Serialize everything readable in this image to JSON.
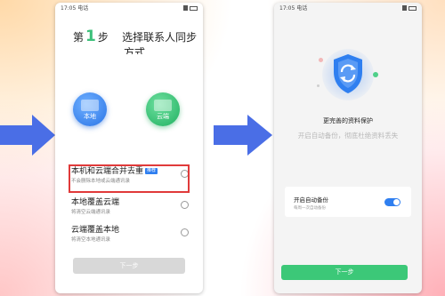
{
  "colors": {
    "accent_green": "#3cc07a",
    "accent_blue": "#2f7ff0",
    "highlight_red": "#e03a3a",
    "arrow_blue": "#4a6ee6"
  },
  "left_screen": {
    "status_time": "17:05",
    "status_text": "电话",
    "step_prefix": "第",
    "step_number": "1",
    "step_suffix": "步",
    "title_line1": "选择联系人同步",
    "title_line2": "方式",
    "option_local_label": "本地",
    "option_cloud_label": "云端",
    "options": [
      {
        "main": "本机和云端合并去重",
        "badge": "推荐",
        "sub": "不会删除本地或云端通讯录"
      },
      {
        "main": "本地覆盖云端",
        "sub": "将清空云端通讯录"
      },
      {
        "main": "云端覆盖本地",
        "sub": "将清空本地通讯录"
      }
    ],
    "next_button": "下一步"
  },
  "right_screen": {
    "status_time": "17:05",
    "status_text": "电话",
    "icon": "shield-sync-icon",
    "headline": "更完善的资料保护",
    "subline": "开启自动备份，彻底杜绝资料丢失",
    "auto_backup_title": "开启自动备份",
    "auto_backup_desc": "每周一次自动备份",
    "auto_backup_enabled": true,
    "next_button": "下一步"
  }
}
